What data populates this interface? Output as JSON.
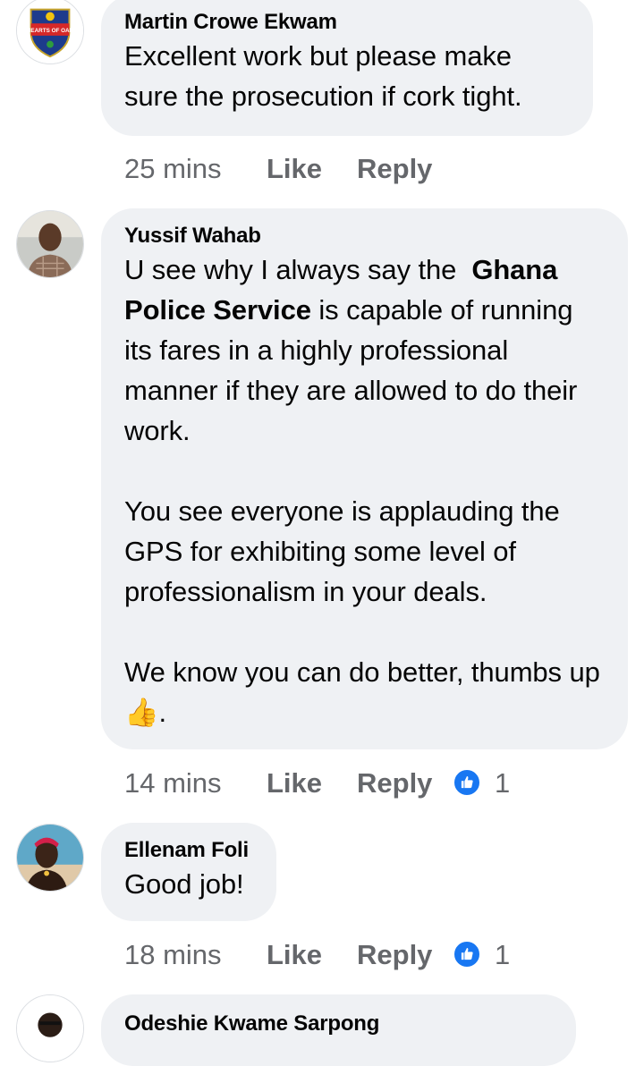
{
  "comments": [
    {
      "name": "Martin Crowe Ekwam",
      "text": "Excellent work but please make\nsure the prosecution if cork tight.",
      "time": "25 mins",
      "like_label": "Like",
      "reply_label": "Reply",
      "avatar": "hearts-of-oak-crest",
      "avatar_text": "HEARTS OF OAK"
    },
    {
      "name": "Yussif Wahab",
      "text_before": "U see why I always say the  ",
      "text_bold": "Ghana Police Service",
      "text_after": " is capable of running its fares in a highly professional manner if they are allowed to do their work.",
      "text_p2": "You see everyone is applauding the GPS for exhibiting some level of professionalism in your deals.",
      "text_p3": "We know you can do better, thumbs up",
      "emoji": "👍",
      "text_p3_end": ".",
      "time": "14 mins",
      "like_label": "Like",
      "reply_label": "Reply",
      "reaction_count": "1",
      "avatar": "profile-photo-man"
    },
    {
      "name": "Ellenam Foli",
      "text": "Good job!",
      "time": "18 mins",
      "like_label": "Like",
      "reply_label": "Reply",
      "reaction_count": "1",
      "avatar": "profile-photo-woman"
    },
    {
      "name": "Odeshie Kwame Sarpong",
      "avatar": "profile-photo-partial"
    }
  ],
  "colors": {
    "bubble": "#eff1f4",
    "meta_text": "#65676b",
    "like_blue": "#1877f2"
  }
}
